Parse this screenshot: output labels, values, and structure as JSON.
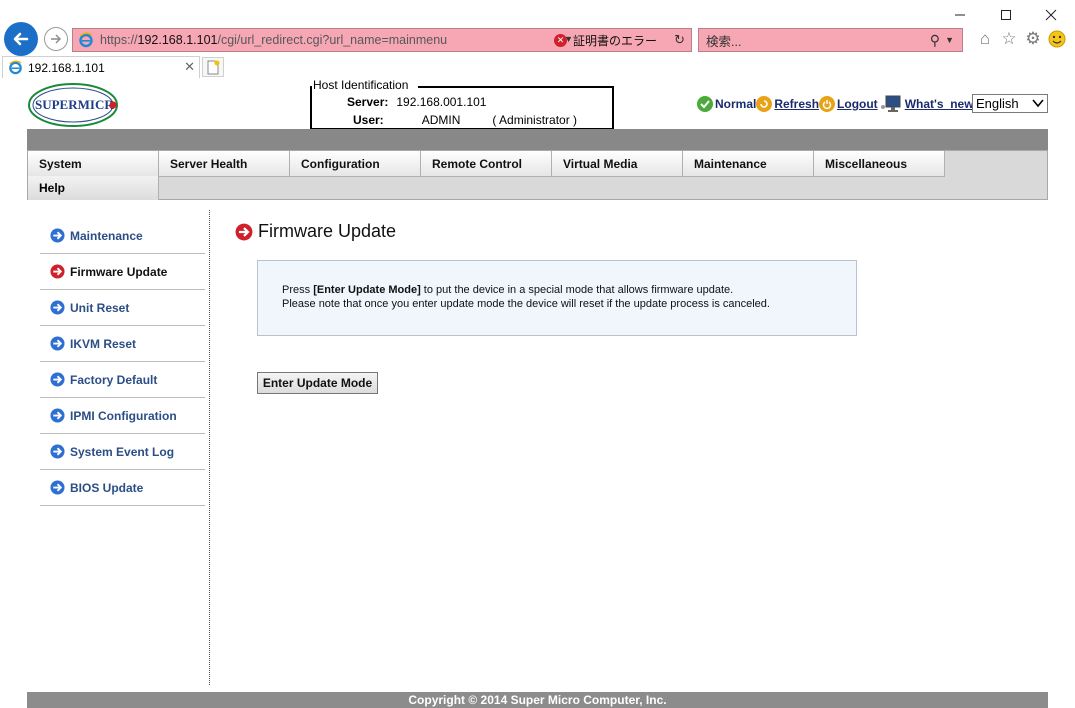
{
  "browser": {
    "url_scheme": "https://",
    "url_host": "192.168.1.101",
    "url_path": "/cgi/url_redirect.cgi?url_name=mainmenu",
    "cert_error": "証明書のエラー",
    "search_placeholder": "検索...",
    "tab_title": "192.168.1.101"
  },
  "header": {
    "host_legend": "Host Identification",
    "server_label": "Server:",
    "server_value": "192.168.001.101",
    "user_label": "User:",
    "user_value": "ADMIN",
    "user_role": "( Administrator )",
    "links": {
      "normal": "Normal",
      "refresh": "Refresh",
      "logout": "Logout",
      "whats_new": "What's  new"
    },
    "language": "English"
  },
  "menu": {
    "items": [
      "System",
      "Server Health",
      "Configuration",
      "Remote Control",
      "Virtual Media",
      "Maintenance",
      "Miscellaneous"
    ],
    "help": "Help"
  },
  "sidebar": {
    "items": [
      "Maintenance",
      "Firmware Update",
      "Unit Reset",
      "IKVM Reset",
      "Factory Default",
      "IPMI Configuration",
      "System Event Log",
      "BIOS Update"
    ],
    "active_index": 1
  },
  "main": {
    "title": "Firmware Update",
    "info_pre": "Press ",
    "info_bold": "[Enter Update Mode]",
    "info_post": " to put the device in a special mode that allows firmware update.",
    "info_line2": "Please note that once you enter update mode the device will reset if the update process is canceled.",
    "button_label": "Enter Update Mode"
  },
  "footer": {
    "copyright": "Copyright © 2014 Super Micro Computer, Inc."
  },
  "colors": {
    "accent_blue": "#2b4e86",
    "active_red": "#d0202a",
    "address_bar_error": "#f6a7b3"
  }
}
